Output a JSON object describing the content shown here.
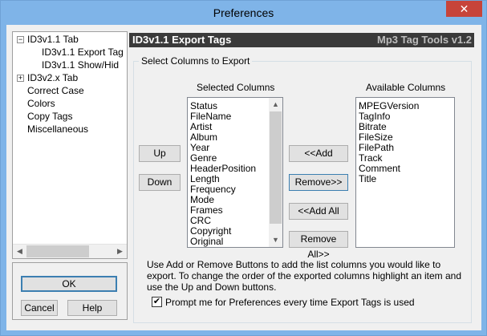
{
  "window": {
    "title": "Preferences",
    "close_glyph": "✕"
  },
  "tree": {
    "items": [
      {
        "label": "ID3v1.1 Tab",
        "expander": "−"
      },
      {
        "label": "ID3v1.1 Export Tag"
      },
      {
        "label": "ID3v1.1 Show/Hid"
      },
      {
        "label": "ID3v2.x Tab",
        "expander": "+"
      },
      {
        "label": "Correct Case"
      },
      {
        "label": "Colors"
      },
      {
        "label": "Copy Tags"
      },
      {
        "label": "Miscellaneous"
      }
    ],
    "scroll_left": "◀",
    "scroll_right": "▶"
  },
  "buttons": {
    "ok": "OK",
    "cancel": "Cancel",
    "help": "Help"
  },
  "header": {
    "title": "ID3v1.1 Export Tags",
    "brand": "Mp3 Tag Tools v1.2"
  },
  "group": {
    "legend": "Select Columns to Export"
  },
  "selected": {
    "label": "Selected Columns",
    "items": [
      "Status",
      "FileName",
      "Artist",
      "Album",
      "Year",
      "Genre",
      "HeaderPosition",
      "Length",
      "Frequency",
      "Mode",
      "Frames",
      "CRC",
      "Copyright",
      "Original"
    ],
    "scroll_up": "▲",
    "scroll_down": "▼"
  },
  "available": {
    "label": "Available Columns",
    "items": [
      "MPEGVersion",
      "TagInfo",
      "Bitrate",
      "FileSize",
      "FilePath",
      "Track",
      "Comment",
      "Title"
    ]
  },
  "move": {
    "up": "Up",
    "down": "Down"
  },
  "transfer": {
    "add": "<<Add",
    "remove": "Remove>>",
    "add_all": "<<Add All",
    "remove_all": "Remove All>>"
  },
  "description": "Use Add or Remove Buttons to add the list columns you would like to export. To change the order of the exported columns highlight an item and use the Up and Down buttons.",
  "prompt": {
    "checked": true,
    "check_glyph": "✔",
    "label": "Prompt me for Preferences every time Export Tags is used"
  }
}
